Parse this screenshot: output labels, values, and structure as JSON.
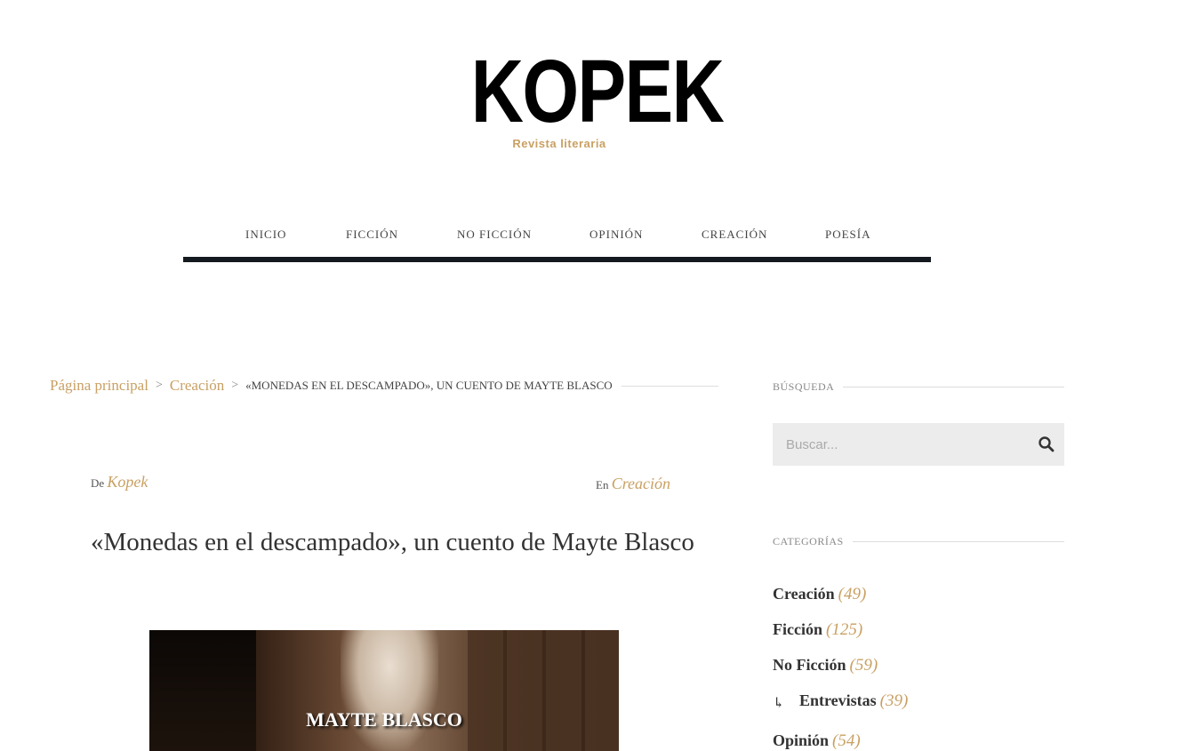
{
  "site": {
    "title": "KOPEK",
    "subtitle": "Revista literaria"
  },
  "nav": {
    "items": [
      "INICIO",
      "FICCIÓN",
      "NO FICCIÓN",
      "OPINIÓN",
      "CREACIÓN",
      "POESÍA"
    ]
  },
  "breadcrumb": {
    "home": "Página principal",
    "separator": ">",
    "category": "Creación",
    "current": "«Monedas en el descampado», un cuento de Mayte Blasco"
  },
  "post": {
    "author_prefix": "De",
    "author": "Kopek",
    "category_prefix": "En",
    "category": "Creación",
    "title": "«Monedas en el descampado», un cuento de Mayte Blasco",
    "image_caption": "MAYTE BLASCO"
  },
  "sidebar": {
    "search_title": "Búsqueda",
    "search_placeholder": "Buscar...",
    "search_icon": "search-icon",
    "categories_title": "Categorías",
    "categories": [
      {
        "name": "Creación",
        "count": "(49)"
      },
      {
        "name": "Ficción",
        "count": "(125)"
      },
      {
        "name": "No Ficción",
        "count": "(59)"
      },
      {
        "name": "Entrevistas",
        "count": "(39)",
        "sub": true,
        "icon": "subcategory-arrow-icon",
        "arrow": "↳"
      },
      {
        "name": "Opinión",
        "count": "(54)"
      }
    ]
  },
  "colors": {
    "accent": "#c9a063",
    "nav_border": "#141a1f",
    "text": "#333333"
  }
}
